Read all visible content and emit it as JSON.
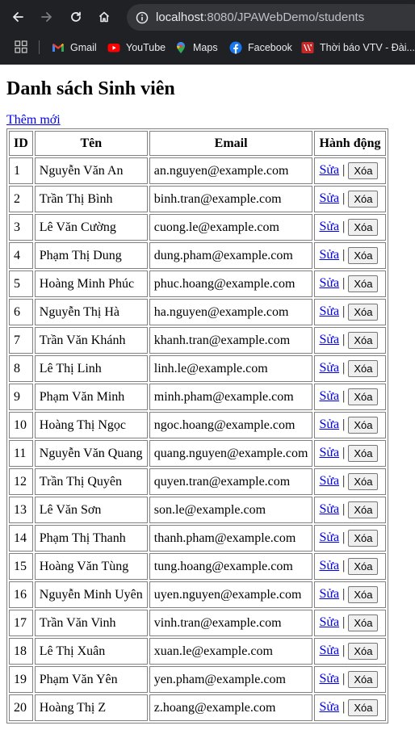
{
  "browser": {
    "url_host": "localhost",
    "url_path": ":8080/JPAWebDemo/students",
    "bookmarks": [
      {
        "label": "Gmail",
        "icon": "gmail-icon"
      },
      {
        "label": "YouTube",
        "icon": "youtube-icon"
      },
      {
        "label": "Maps",
        "icon": "maps-icon"
      },
      {
        "label": "Facebook",
        "icon": "facebook-icon"
      },
      {
        "label": "Thời báo VTV - Đài...",
        "icon": "vtv-icon"
      }
    ]
  },
  "page": {
    "title": "Danh sách Sinh viên",
    "add_link": "Thêm mới",
    "table": {
      "headers": [
        "ID",
        "Tên",
        "Email",
        "Hành động"
      ],
      "edit_label": "Sửa",
      "separator": "|",
      "delete_label": "Xóa",
      "rows": [
        {
          "id": "1",
          "name": "Nguyễn Văn An",
          "email": "an.nguyen@example.com"
        },
        {
          "id": "2",
          "name": "Trần Thị Bình",
          "email": "binh.tran@example.com"
        },
        {
          "id": "3",
          "name": "Lê Văn Cường",
          "email": "cuong.le@example.com"
        },
        {
          "id": "4",
          "name": "Phạm Thị Dung",
          "email": "dung.pham@example.com"
        },
        {
          "id": "5",
          "name": "Hoàng Minh Phúc",
          "email": "phuc.hoang@example.com"
        },
        {
          "id": "6",
          "name": "Nguyễn Thị Hà",
          "email": "ha.nguyen@example.com"
        },
        {
          "id": "7",
          "name": "Trần Văn Khánh",
          "email": "khanh.tran@example.com"
        },
        {
          "id": "8",
          "name": "Lê Thị Linh",
          "email": "linh.le@example.com"
        },
        {
          "id": "9",
          "name": "Phạm Văn Minh",
          "email": "minh.pham@example.com"
        },
        {
          "id": "10",
          "name": "Hoàng Thị Ngọc",
          "email": "ngoc.hoang@example.com"
        },
        {
          "id": "11",
          "name": "Nguyễn Văn Quang",
          "email": "quang.nguyen@example.com"
        },
        {
          "id": "12",
          "name": "Trần Thị Quyên",
          "email": "quyen.tran@example.com"
        },
        {
          "id": "13",
          "name": "Lê Văn Sơn",
          "email": "son.le@example.com"
        },
        {
          "id": "14",
          "name": "Phạm Thị Thanh",
          "email": "thanh.pham@example.com"
        },
        {
          "id": "15",
          "name": "Hoàng Văn Tùng",
          "email": "tung.hoang@example.com"
        },
        {
          "id": "16",
          "name": "Nguyễn Minh Uyên",
          "email": "uyen.nguyen@example.com"
        },
        {
          "id": "17",
          "name": "Trần Văn Vinh",
          "email": "vinh.tran@example.com"
        },
        {
          "id": "18",
          "name": "Lê Thị Xuân",
          "email": "xuan.le@example.com"
        },
        {
          "id": "19",
          "name": "Phạm Văn Yên",
          "email": "yen.pham@example.com"
        },
        {
          "id": "20",
          "name": "Hoàng Thị Z",
          "email": "z.hoang@example.com"
        }
      ]
    }
  }
}
